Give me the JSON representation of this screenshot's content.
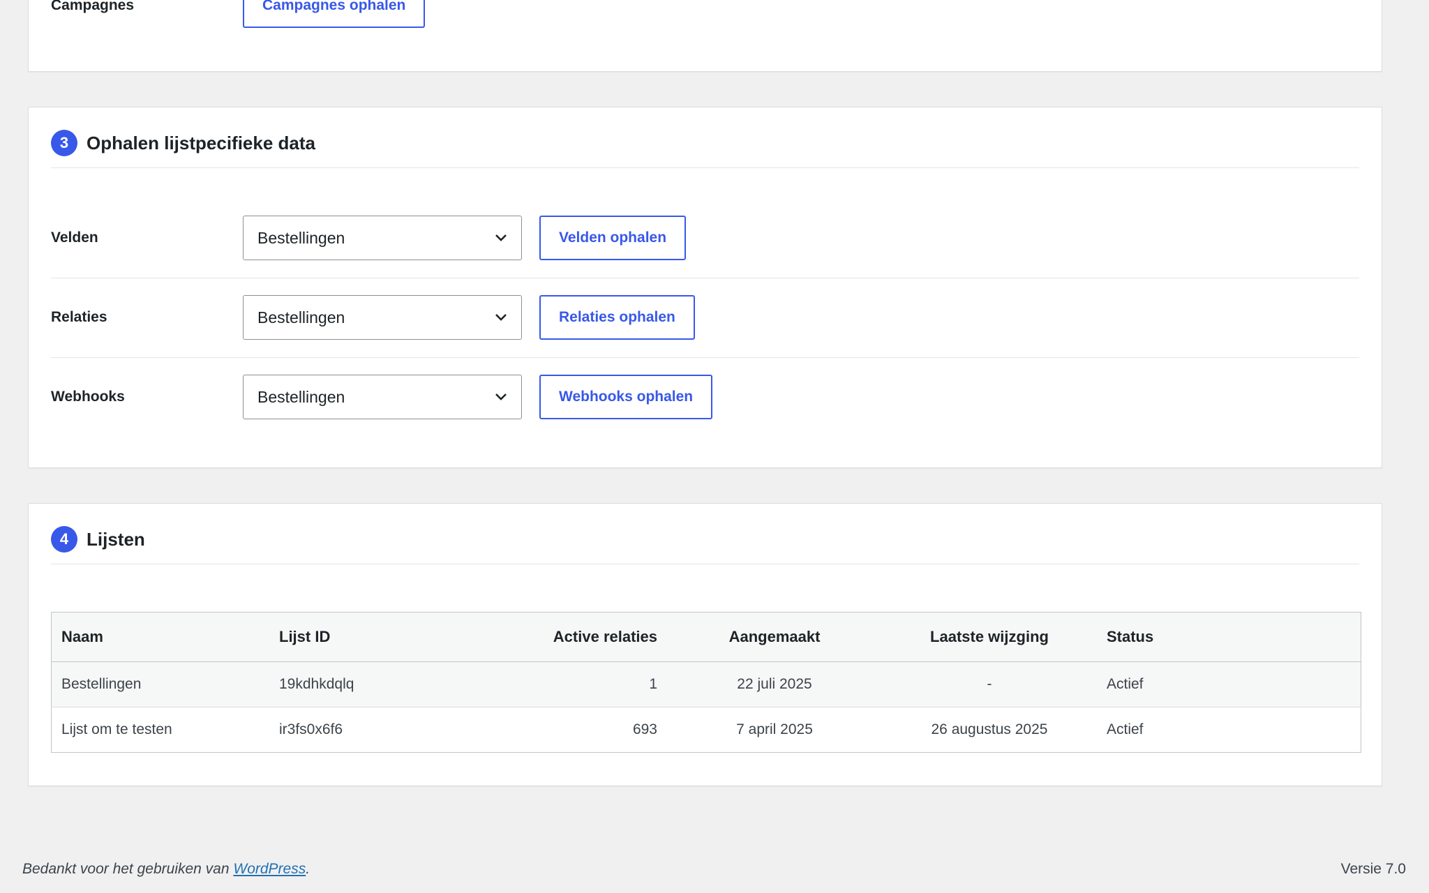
{
  "section_top": {
    "label": "Campagnes",
    "button": "Campagnes ophalen"
  },
  "section3": {
    "number": "3",
    "title": "Ophalen lijstpecifieke data",
    "rows": [
      {
        "label": "Velden",
        "selected": "Bestellingen",
        "button": "Velden ophalen"
      },
      {
        "label": "Relaties",
        "selected": "Bestellingen",
        "button": "Relaties ophalen"
      },
      {
        "label": "Webhooks",
        "selected": "Bestellingen",
        "button": "Webhooks ophalen"
      }
    ]
  },
  "section4": {
    "number": "4",
    "title": "Lijsten",
    "columns": [
      "Naam",
      "Lijst ID",
      "Active relaties",
      "Aangemaakt",
      "Laatste wijzging",
      "Status"
    ],
    "rows": [
      [
        "Bestellingen",
        "19kdhkdqlq",
        "1",
        "22 juli 2025",
        "-",
        "Actief"
      ],
      [
        "Lijst om te testen",
        "ir3fs0x6f6",
        "693",
        "7 april 2025",
        "26 augustus 2025",
        "Actief"
      ]
    ]
  },
  "footer": {
    "thanks_prefix": "Bedankt voor het gebruiken van ",
    "link": "WordPress",
    "suffix": ".",
    "version": "Versie 7.0"
  },
  "colors": {
    "accent": "#3858e9",
    "background": "#f0f0f1",
    "link": "#2271b1"
  },
  "icons": {
    "dropdown": "chevron-down-icon"
  }
}
